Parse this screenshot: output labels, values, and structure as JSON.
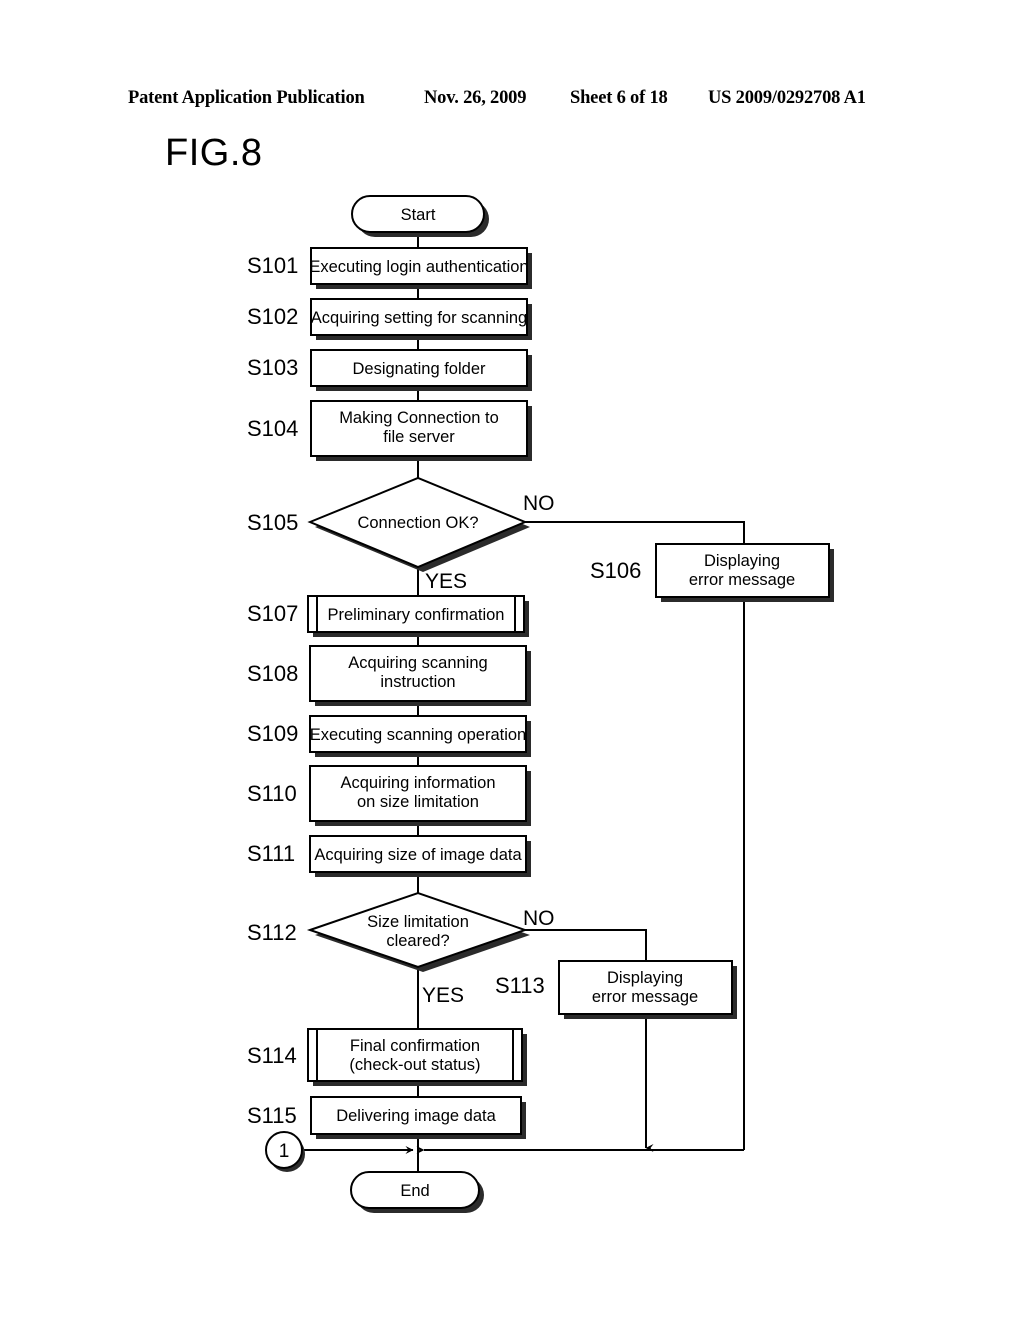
{
  "header": {
    "publication": "Patent Application Publication",
    "date": "Nov. 26, 2009",
    "sheet": "Sheet 6 of 18",
    "patent_number": "US 2009/0292708 A1"
  },
  "figure": {
    "title": "FIG.8"
  },
  "flowchart": {
    "terminators": {
      "start": "Start",
      "end": "End"
    },
    "connector": {
      "label": "1"
    },
    "branch_labels": {
      "yes": "YES",
      "no": "NO"
    },
    "steps": [
      {
        "id": "S101",
        "label": "S101",
        "text": "Executing login authentication",
        "lines": [
          "Executing login authentication"
        ],
        "type": "process"
      },
      {
        "id": "S102",
        "label": "S102",
        "text": "Acquiring setting for scanning",
        "lines": [
          "Acquiring setting for scanning"
        ],
        "type": "process"
      },
      {
        "id": "S103",
        "label": "S103",
        "text": "Designating folder",
        "lines": [
          "Designating folder"
        ],
        "type": "process"
      },
      {
        "id": "S104",
        "label": "S104",
        "text": "Making Connection to file server",
        "lines": [
          "Making Connection to",
          "file server"
        ],
        "type": "process"
      },
      {
        "id": "S105",
        "label": "S105",
        "text": "Connection OK?",
        "lines": [
          "Connection OK?"
        ],
        "type": "decision"
      },
      {
        "id": "S106",
        "label": "S106",
        "text": "Displaying error message",
        "lines": [
          "Displaying",
          "error message"
        ],
        "type": "process"
      },
      {
        "id": "S107",
        "label": "S107",
        "text": "Preliminary confirmation",
        "lines": [
          "Preliminary confirmation"
        ],
        "type": "predefined-process"
      },
      {
        "id": "S108",
        "label": "S108",
        "text": "Acquiring scanning instruction",
        "lines": [
          "Acquiring scanning",
          "instruction"
        ],
        "type": "process"
      },
      {
        "id": "S109",
        "label": "S109",
        "text": "Executing scanning operation",
        "lines": [
          "Executing scanning operation"
        ],
        "type": "process"
      },
      {
        "id": "S110",
        "label": "S110",
        "text": "Acquiring information on  size limitation",
        "lines": [
          "Acquiring information",
          "on  size limitation"
        ],
        "type": "process"
      },
      {
        "id": "S111",
        "label": "S111",
        "text": "Acquiring size of image data",
        "lines": [
          "Acquiring size of image data"
        ],
        "type": "process"
      },
      {
        "id": "S112",
        "label": "S112",
        "text": "Size limitation cleared?",
        "lines": [
          "Size limitation",
          "cleared?"
        ],
        "type": "decision"
      },
      {
        "id": "S113",
        "label": "S113",
        "text": "Displaying error message",
        "lines": [
          "Displaying",
          "error message"
        ],
        "type": "process"
      },
      {
        "id": "S114",
        "label": "S114",
        "text": "Final confirmation (check-out status)",
        "lines": [
          "Final confirmation",
          "(check-out status)"
        ],
        "type": "predefined-process"
      },
      {
        "id": "S115",
        "label": "S115",
        "text": "Delivering image data",
        "lines": [
          "Delivering image data"
        ],
        "type": "process"
      }
    ]
  },
  "colors": {
    "ink": "#000000",
    "paper": "#ffffff",
    "shadow": "#2b2b2b"
  }
}
